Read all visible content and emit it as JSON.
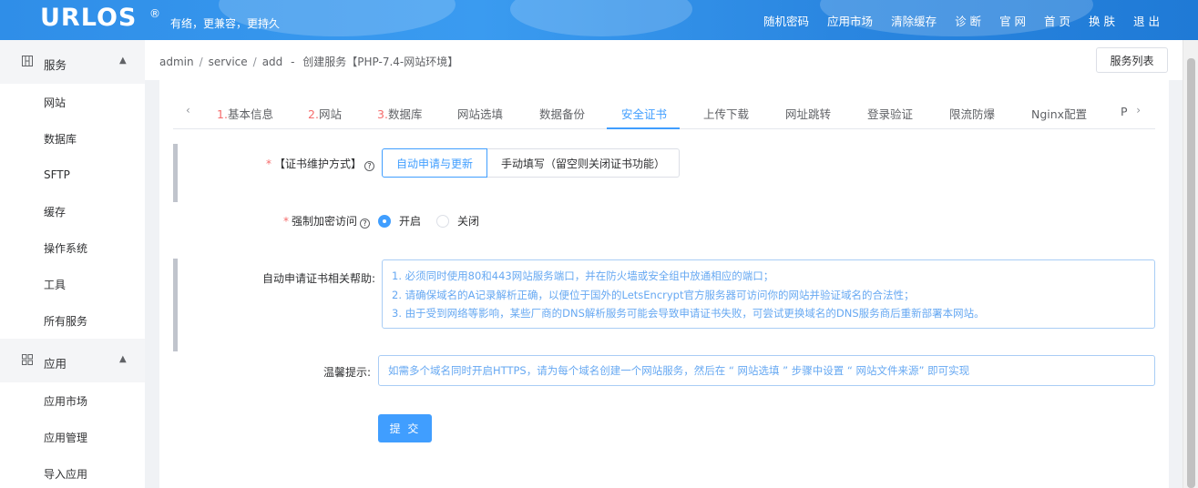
{
  "header": {
    "logo": "URLOS",
    "logo_mark": "®",
    "slogan": "有络，更兼容，更持久",
    "nav": [
      "随机密码",
      "应用市场",
      "清除缓存",
      "诊 断",
      "官 网",
      "首 页",
      "换 肤",
      "退 出"
    ]
  },
  "sidebar": {
    "groups": [
      {
        "label": "服务",
        "icon": "grid-icon",
        "items": [
          "网站",
          "数据库",
          "SFTP",
          "缓存",
          "操作系统",
          "工具",
          "所有服务"
        ]
      },
      {
        "label": "应用",
        "icon": "apps-icon",
        "items": [
          "应用市场",
          "应用管理",
          "导入应用"
        ]
      }
    ]
  },
  "breadcrumb": {
    "parts": [
      "admin",
      "service",
      "add"
    ],
    "current": "创建服务【PHP-7.4-网站环境】",
    "dash": "-",
    "button": "服务列表"
  },
  "tabs": [
    {
      "num": "1.",
      "label": "基本信息"
    },
    {
      "num": "2.",
      "label": "网站"
    },
    {
      "num": "3.",
      "label": "数据库"
    },
    {
      "num": "",
      "label": "网站选填"
    },
    {
      "num": "",
      "label": "数据备份"
    },
    {
      "num": "",
      "label": "安全证书"
    },
    {
      "num": "",
      "label": "上传下载"
    },
    {
      "num": "",
      "label": "网址跳转"
    },
    {
      "num": "",
      "label": "登录验证"
    },
    {
      "num": "",
      "label": "限流防爆"
    },
    {
      "num": "",
      "label": "Nginx配置"
    },
    {
      "num": "",
      "label": "P"
    }
  ],
  "active_tab": "安全证书",
  "form": {
    "cert_mode": {
      "label": "【证书维护方式】",
      "options": [
        "自动申请与更新",
        "手动填写（留空则关闭证书功能）"
      ],
      "selected": "自动申请与更新"
    },
    "force_https": {
      "label": "强制加密访问",
      "options": [
        "开启",
        "关闭"
      ],
      "selected": "开启"
    },
    "help": {
      "label": "自动申请证书相关帮助:",
      "lines": [
        "1. 必须同时使用80和443网站服务端口，并在防火墙或安全组中放通相应的端口；",
        "2. 请确保域名的A记录解析正确，以便位于国外的LetsEncrypt官方服务器可访问你的网站并验证域名的合法性；",
        "3. 由于受到网络等影响，某些厂商的DNS解析服务可能会导致申请证书失败，可尝试更换域名的DNS服务商后重新部署本网站。"
      ]
    },
    "tip": {
      "label": "温馨提示:",
      "text": "如需多个域名同时开启HTTPS，请为每个域名创建一个网站服务，然后在 “ 网站选填 ” 步骤中设置 “ 网站文件来源” 即可实现"
    },
    "submit": "提 交"
  }
}
